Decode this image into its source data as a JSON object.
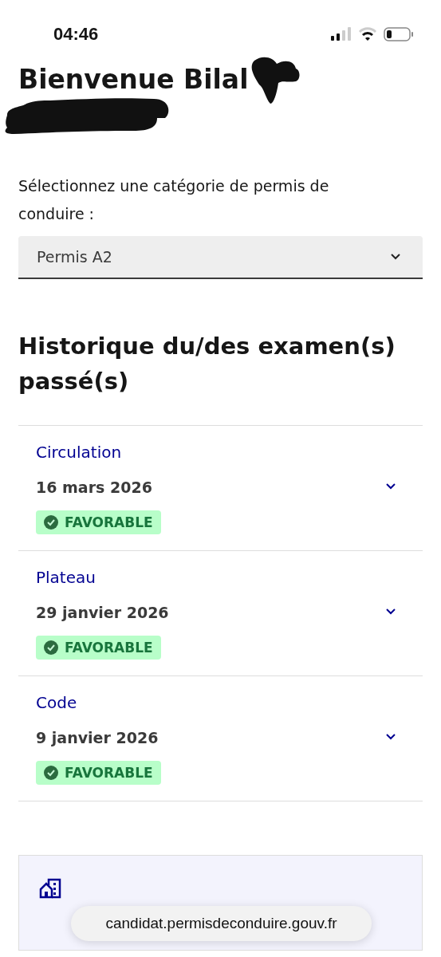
{
  "status_bar": {
    "time": "04:46"
  },
  "greeting": "Bienvenue Bilal",
  "category_select": {
    "label": "Sélectionnez une catégorie de permis de conduire :",
    "value": "Permis A2"
  },
  "history": {
    "title": "Historique du/des examen(s) passé(s)",
    "exams": [
      {
        "name": "Circulation",
        "date": "16 mars 2026",
        "result": "FAVORABLE",
        "kind": "success",
        "expanded": false
      },
      {
        "name": "Plateau",
        "date": "29 janvier 2026",
        "result": "FAVORABLE",
        "kind": "success",
        "expanded": false
      },
      {
        "name": "Code",
        "date": "9 janvier 2026",
        "result": "FAVORABLE",
        "kind": "success",
        "expanded": false
      }
    ]
  },
  "address_bar": {
    "url": "candidat.permisdeconduire.gouv.fr"
  }
}
